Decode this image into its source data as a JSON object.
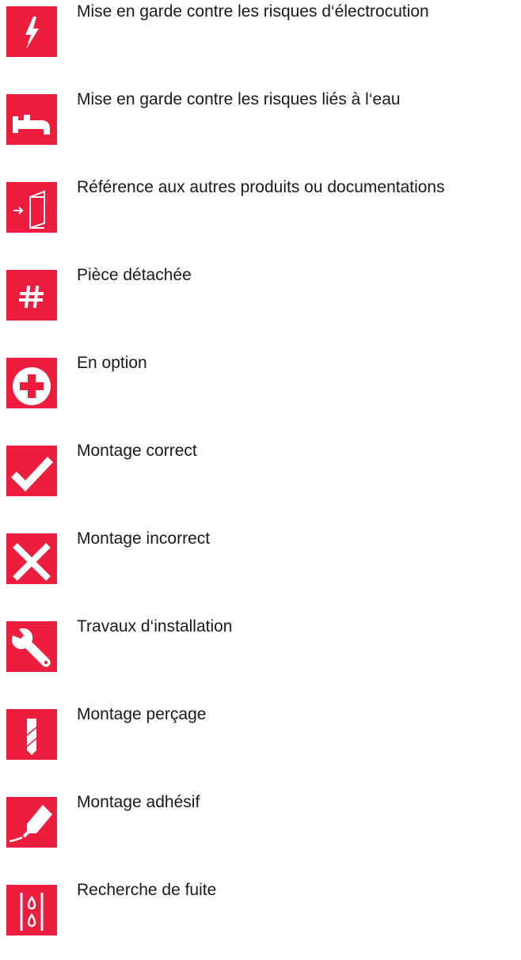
{
  "theme": {
    "accent": "#EC1D3D",
    "text": "#1a1a1a",
    "background": "#ffffff"
  },
  "legend": {
    "items": [
      {
        "icon": "lightning-icon",
        "label": "Mise en garde contre les risques d‘électrocution"
      },
      {
        "icon": "faucet-icon",
        "label": "Mise en garde contre les risques liés à l‘eau"
      },
      {
        "icon": "document-reference-icon",
        "label": "Référence aux autres produits ou documentations"
      },
      {
        "icon": "hash-icon",
        "label": "Pièce détachée"
      },
      {
        "icon": "plus-circle-icon",
        "label": "En option"
      },
      {
        "icon": "checkmark-icon",
        "label": "Montage correct"
      },
      {
        "icon": "cross-icon",
        "label": "Montage incorrect"
      },
      {
        "icon": "wrench-icon",
        "label": "Travaux d‘installation"
      },
      {
        "icon": "drill-bit-icon",
        "label": "Montage perçage"
      },
      {
        "icon": "adhesive-tube-icon",
        "label": "Montage adhésif"
      },
      {
        "icon": "leak-drops-icon",
        "label": "Recherche de fuite"
      }
    ]
  }
}
